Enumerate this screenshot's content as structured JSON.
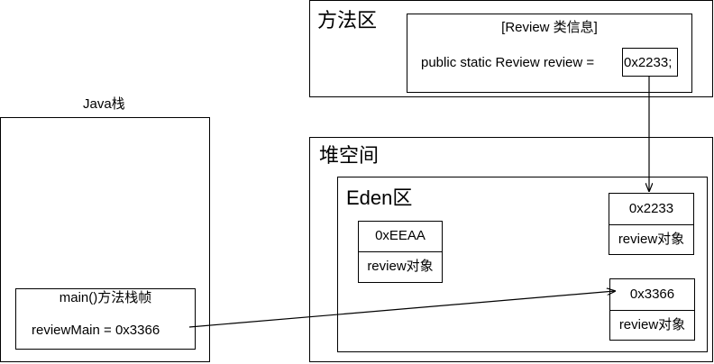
{
  "method_area": {
    "title": "方法区",
    "class_info": {
      "header": "[Review 类信息]",
      "field_decl": "public static Review review = ",
      "field_value": "0x2233;"
    }
  },
  "heap": {
    "title": "堆空间",
    "eden": {
      "title": "Eden区",
      "objects": [
        {
          "address": "0xEEAA",
          "label": "review对象"
        },
        {
          "address": "0x2233",
          "label": "review对象"
        },
        {
          "address": "0x3366",
          "label": "review对象"
        }
      ]
    }
  },
  "java_stack": {
    "title": "Java栈",
    "frame": {
      "header": "main()方法栈帧",
      "var_line": "reviewMain = 0x3366"
    }
  }
}
